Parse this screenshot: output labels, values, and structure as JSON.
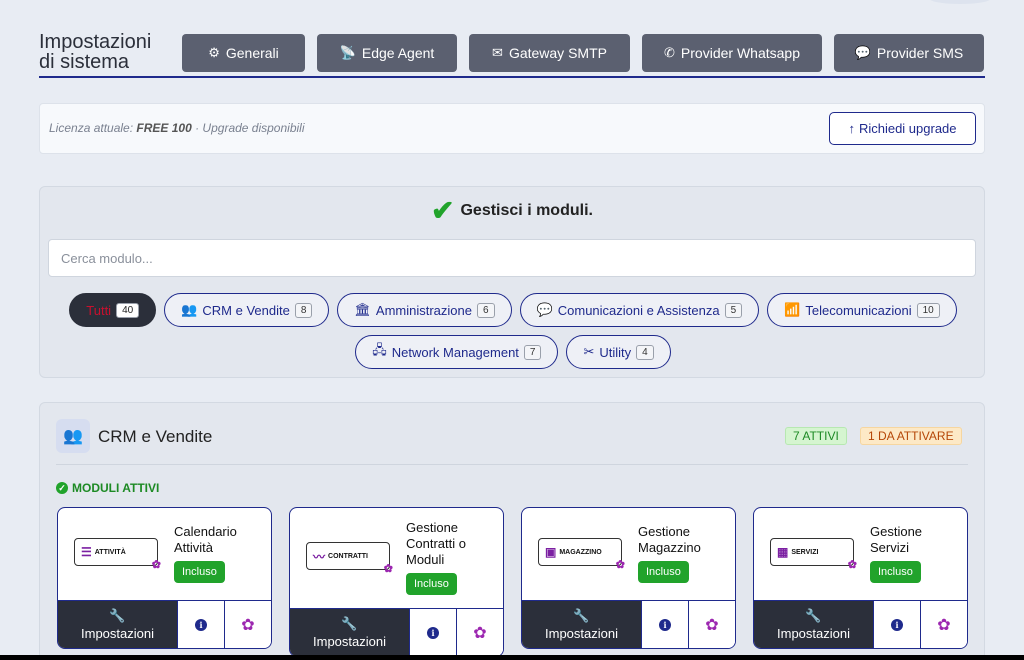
{
  "header": {
    "title": "Impostazioni di sistema",
    "tabs": [
      {
        "label": "Generali",
        "icon": "gears-icon"
      },
      {
        "label": "Edge Agent",
        "icon": "satellite-dish-icon"
      },
      {
        "label": "Gateway SMTP",
        "icon": "envelope-icon"
      },
      {
        "label": "Provider Whatsapp",
        "icon": "whatsapp-icon"
      },
      {
        "label": "Provider SMS",
        "icon": "comment-dots-icon"
      }
    ]
  },
  "license": {
    "prefix": "Licenza attuale: ",
    "plan": "FREE 100",
    "suffix": " · Upgrade disponibili",
    "upgrade_label": "Richiedi upgrade"
  },
  "modules": {
    "title": "Gestisci i moduli.",
    "search_placeholder": "Cerca modulo...",
    "filters": [
      {
        "label": "Tutti",
        "count": "40",
        "active": true
      },
      {
        "label": "CRM e Vendite",
        "count": "8",
        "icon": "users-icon"
      },
      {
        "label": "Amministrazione",
        "count": "6",
        "icon": "landmark-icon"
      },
      {
        "label": "Comunicazioni e Assistenza",
        "count": "5",
        "icon": "comments-icon"
      },
      {
        "label": "Telecomunicazioni",
        "count": "10",
        "icon": "tower-broadcast-icon"
      },
      {
        "label": "Network Management",
        "count": "7",
        "icon": "network-icon"
      },
      {
        "label": "Utility",
        "count": "4",
        "icon": "tools-icon"
      }
    ]
  },
  "section": {
    "title": "CRM e Vendite",
    "badge_active": "7 ATTIVI",
    "badge_todo": "1 DA ATTIVARE",
    "active_label": "MODULI ATTIVI",
    "cards": [
      {
        "name": "Calendario Attività",
        "logo": "ATTIVITÀ",
        "included": "Incluso",
        "settings": "Impostazioni"
      },
      {
        "name": "Gestione Contratti o Moduli",
        "logo": "CONTRATTI",
        "included": "Incluso",
        "settings": "Impostazioni"
      },
      {
        "name": "Gestione Magazzino",
        "logo": "MAGAZZINO",
        "included": "Incluso",
        "settings": "Impostazioni"
      },
      {
        "name": "Gestione Servizi",
        "logo": "SERVIZI",
        "included": "Incluso",
        "settings": "Impostazioni"
      }
    ]
  },
  "colors": {
    "accent": "#1f2a8c",
    "dark": "#2b2f3a",
    "success": "#21a32b",
    "tab": "#5b6070"
  }
}
